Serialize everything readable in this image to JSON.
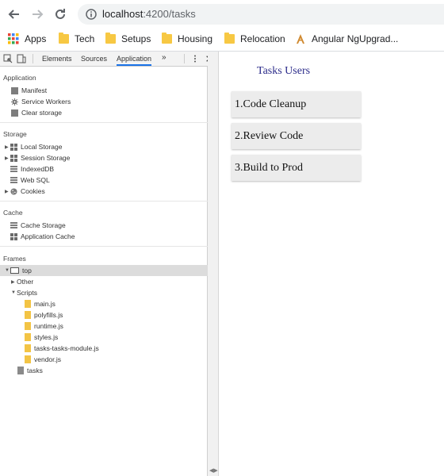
{
  "browser": {
    "url_host": "localhost",
    "url_path": ":4200/tasks",
    "bookmarks": [
      {
        "label": "Apps",
        "icon": "apps-grid-icon"
      },
      {
        "label": "Tech",
        "icon": "folder-icon"
      },
      {
        "label": "Setups",
        "icon": "folder-icon"
      },
      {
        "label": "Housing",
        "icon": "folder-icon"
      },
      {
        "label": "Relocation",
        "icon": "folder-icon"
      },
      {
        "label": "Angular NgUpgrad...",
        "icon": "angular-page-icon"
      }
    ]
  },
  "devtools": {
    "tabs": [
      "Elements",
      "Sources",
      "Application"
    ],
    "active_tab": "Application",
    "more_tabs_glyph": "»",
    "sections": {
      "application": {
        "title": "Application",
        "items": [
          "Manifest",
          "Service Workers",
          "Clear storage"
        ]
      },
      "storage": {
        "title": "Storage",
        "items": [
          "Local Storage",
          "Session Storage",
          "IndexedDB",
          "Web SQL",
          "Cookies"
        ]
      },
      "cache": {
        "title": "Cache",
        "items": [
          "Cache Storage",
          "Application Cache"
        ]
      },
      "frames": {
        "title": "Frames",
        "top": "top",
        "other": "Other",
        "scripts": "Scripts",
        "files": [
          "main.js",
          "polyfills.js",
          "runtime.js",
          "styles.js",
          "tasks-tasks-module.js",
          "vendor.js"
        ],
        "page": "tasks"
      }
    }
  },
  "page": {
    "title": "Tasks Users",
    "tasks": [
      "1.Code Cleanup",
      "2.Review Code",
      "3.Build to Prod"
    ]
  },
  "colors": {
    "title": "#2b2b8a",
    "card_bg": "#ececec",
    "active_tab_underline": "#1a73e8"
  }
}
